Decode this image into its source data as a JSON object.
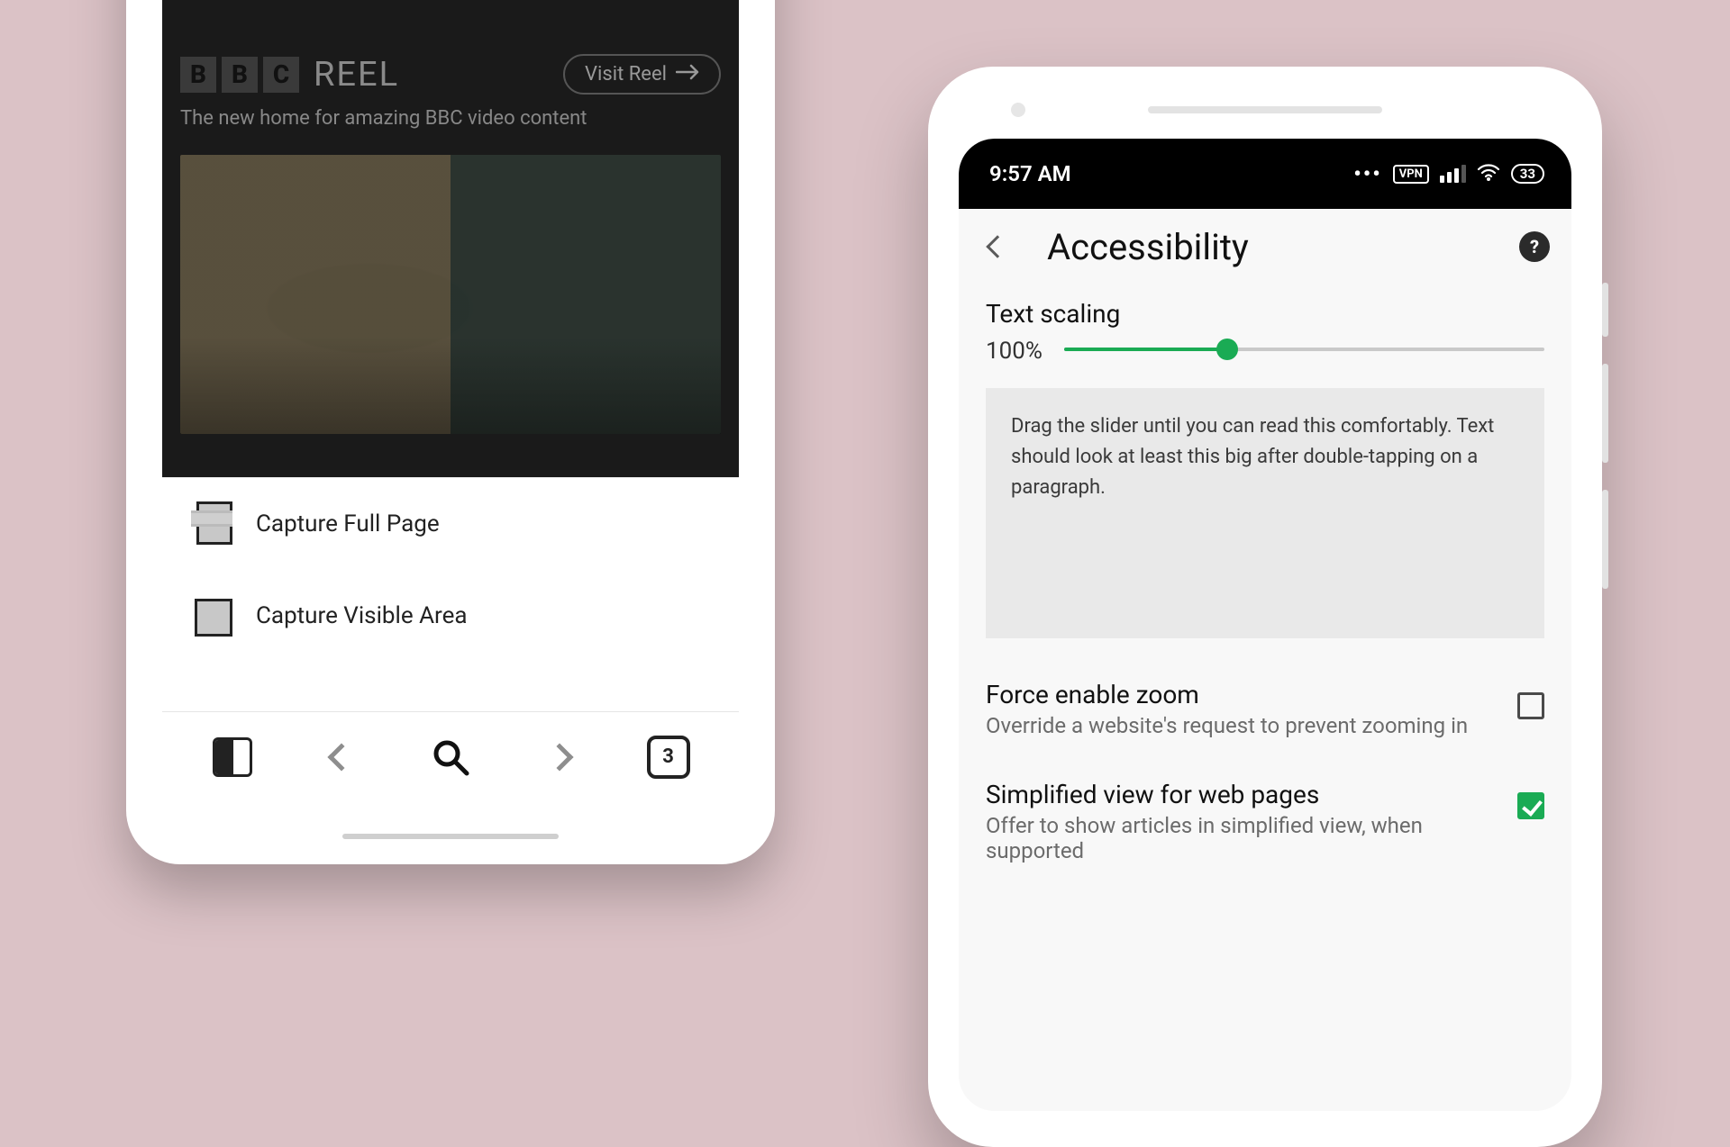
{
  "left_phone": {
    "brand_blocks": [
      "B",
      "B",
      "C"
    ],
    "brand_word": "REEL",
    "visit_label": "Visit Reel",
    "tagline": "The new home for amazing BBC video content",
    "capture_options": {
      "full": "Capture Full Page",
      "visible": "Capture Visible Area"
    },
    "tab_count": "3"
  },
  "right_phone": {
    "status": {
      "time": "9:57 AM",
      "vpn": "VPN",
      "battery": "33"
    },
    "appbar_title": "Accessibility",
    "help_symbol": "?",
    "text_scaling": {
      "label": "Text scaling",
      "value": "100%",
      "sample": "Drag the slider until you can read this comfortably. Text should look at least this big after double-tapping on a paragraph."
    },
    "force_zoom": {
      "title": "Force enable zoom",
      "sub": "Override a website's request to prevent zooming in",
      "checked": false
    },
    "simplified": {
      "title": "Simplified view for web pages",
      "sub": "Offer to show articles in simplified view, when supported",
      "checked": true
    }
  },
  "colors": {
    "accent_green": "#1aab54"
  }
}
